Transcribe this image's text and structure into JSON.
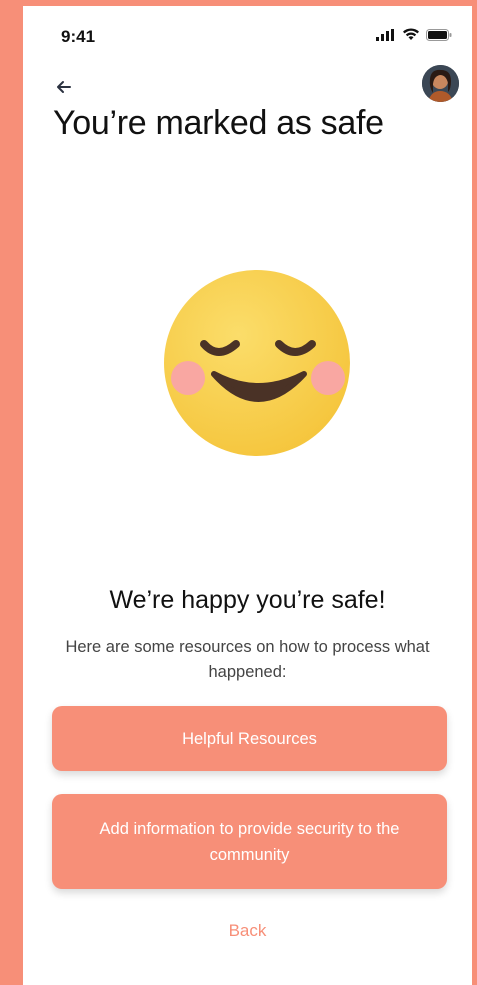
{
  "status_bar": {
    "time": "9:41"
  },
  "header": {
    "title": "You’re marked as safe",
    "avatar_icon": "user-avatar",
    "back_icon": "arrow-left-icon"
  },
  "main": {
    "illustration_icon": "relieved-face-emoji",
    "subtitle": "We’re happy you’re safe!",
    "description": "Here are some resources on how to process what happened:"
  },
  "actions": {
    "helpful_resources_label": "Helpful Resources",
    "add_info_label": "Add information to provide security to the community",
    "back_label": "Back"
  },
  "colors": {
    "accent": "#F78F78",
    "emoji_face": "#F9CF48",
    "emoji_cheek": "#F9A7A2",
    "emoji_features": "#4A3226"
  }
}
